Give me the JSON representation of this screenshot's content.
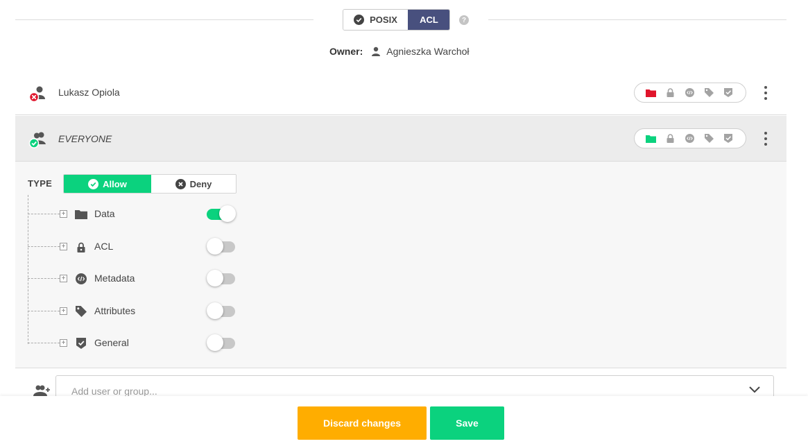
{
  "mode_switch": {
    "posix_label": "POSIX",
    "acl_label": "ACL",
    "selected": "ACL",
    "help": "?"
  },
  "owner": {
    "label": "Owner:",
    "name": "Agnieszka Warchoł"
  },
  "ace_entries": [
    {
      "name": "Lukasz Opiola",
      "type": "deny",
      "status_color": "#e0142b",
      "icons": [
        "folder-icon",
        "lock-icon",
        "metadata-icon",
        "tag-icon",
        "shield-icon"
      ],
      "active_icon": "folder-icon"
    },
    {
      "name": "EVERYONE",
      "type": "allow",
      "status_color": "#0bd27e",
      "icons": [
        "folder-icon",
        "lock-icon",
        "metadata-icon",
        "tag-icon",
        "shield-icon"
      ],
      "active_icon": "folder-icon",
      "expanded": true
    }
  ],
  "editor": {
    "type_label": "TYPE",
    "allow_label": "Allow",
    "deny_label": "Deny",
    "selected_type": "Allow",
    "permissions": [
      {
        "label": "Data",
        "icon": "folder-icon",
        "enabled": true
      },
      {
        "label": "ACL",
        "icon": "lock-icon",
        "enabled": false
      },
      {
        "label": "Metadata",
        "icon": "metadata-icon",
        "enabled": false
      },
      {
        "label": "Attributes",
        "icon": "tag-icon",
        "enabled": false
      },
      {
        "label": "General",
        "icon": "shield-icon",
        "enabled": false
      }
    ]
  },
  "add_user": {
    "placeholder": "Add user or group..."
  },
  "footer": {
    "discard_label": "Discard changes",
    "save_label": "Save"
  },
  "colors": {
    "accent_dark": "#48507e",
    "allow_green": "#0bd27e",
    "deny_red": "#e0142b",
    "discard_orange": "#ffad00"
  }
}
